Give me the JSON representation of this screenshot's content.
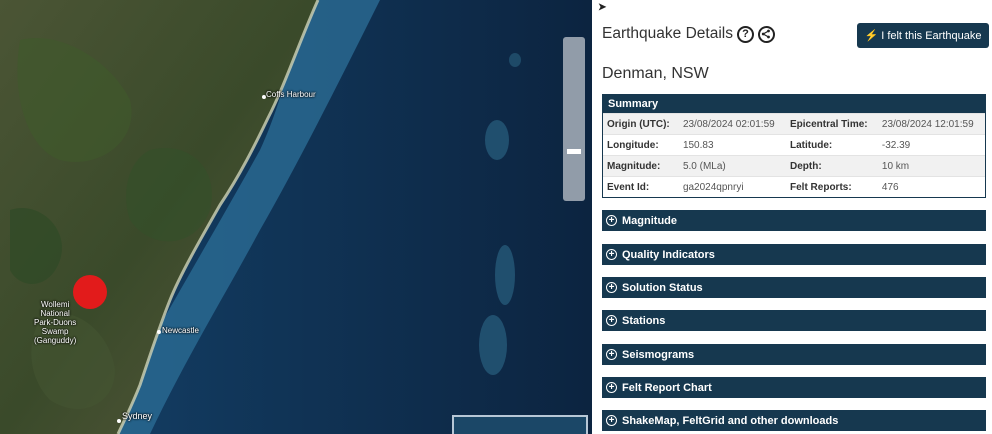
{
  "map": {
    "labels": {
      "coffs_harbour": "Coffs Harbour",
      "newcastle": "Newcastle",
      "sydney": "Sydney",
      "park_lines": [
        "Wollemi",
        "National",
        "Park-Duons",
        "Swamp",
        "(Ganguddy)"
      ]
    },
    "icons": {
      "quake_marker": "red-circle",
      "zoom": "zoom-slider",
      "minimap": "overview-map"
    },
    "colors": {
      "land": "#3f4b2e",
      "coast": "#c9cdb1",
      "shelf": "#2c6f96",
      "ocean": "#0d2740",
      "quake": "#e21b1b"
    }
  },
  "panel": {
    "title": "Earthquake Details",
    "help_icon": "?",
    "felt_button": "I felt this Earthquake",
    "location": "Denman, NSW",
    "summary": {
      "heading": "Summary",
      "rows": [
        {
          "k1": "Origin (UTC):",
          "v1": "23/08/2024 02:01:59",
          "k2": "Epicentral Time:",
          "v2": "23/08/2024 12:01:59"
        },
        {
          "k1": "Longitude:",
          "v1": "150.83",
          "k2": "Latitude:",
          "v2": "-32.39"
        },
        {
          "k1": "Magnitude:",
          "v1": "5.0 (MLa)",
          "k2": "Depth:",
          "v2": "10 km"
        },
        {
          "k1": "Event Id:",
          "v1": "ga2024qpnryi",
          "k2": "Felt Reports:",
          "v2": "476"
        }
      ]
    },
    "sections": [
      "Magnitude",
      "Quality Indicators",
      "Solution Status",
      "Stations",
      "Seismograms",
      "Felt Report Chart",
      "ShakeMap, FeltGrid and other downloads"
    ],
    "colors": {
      "header": "#16384f",
      "text": "#333333"
    }
  }
}
